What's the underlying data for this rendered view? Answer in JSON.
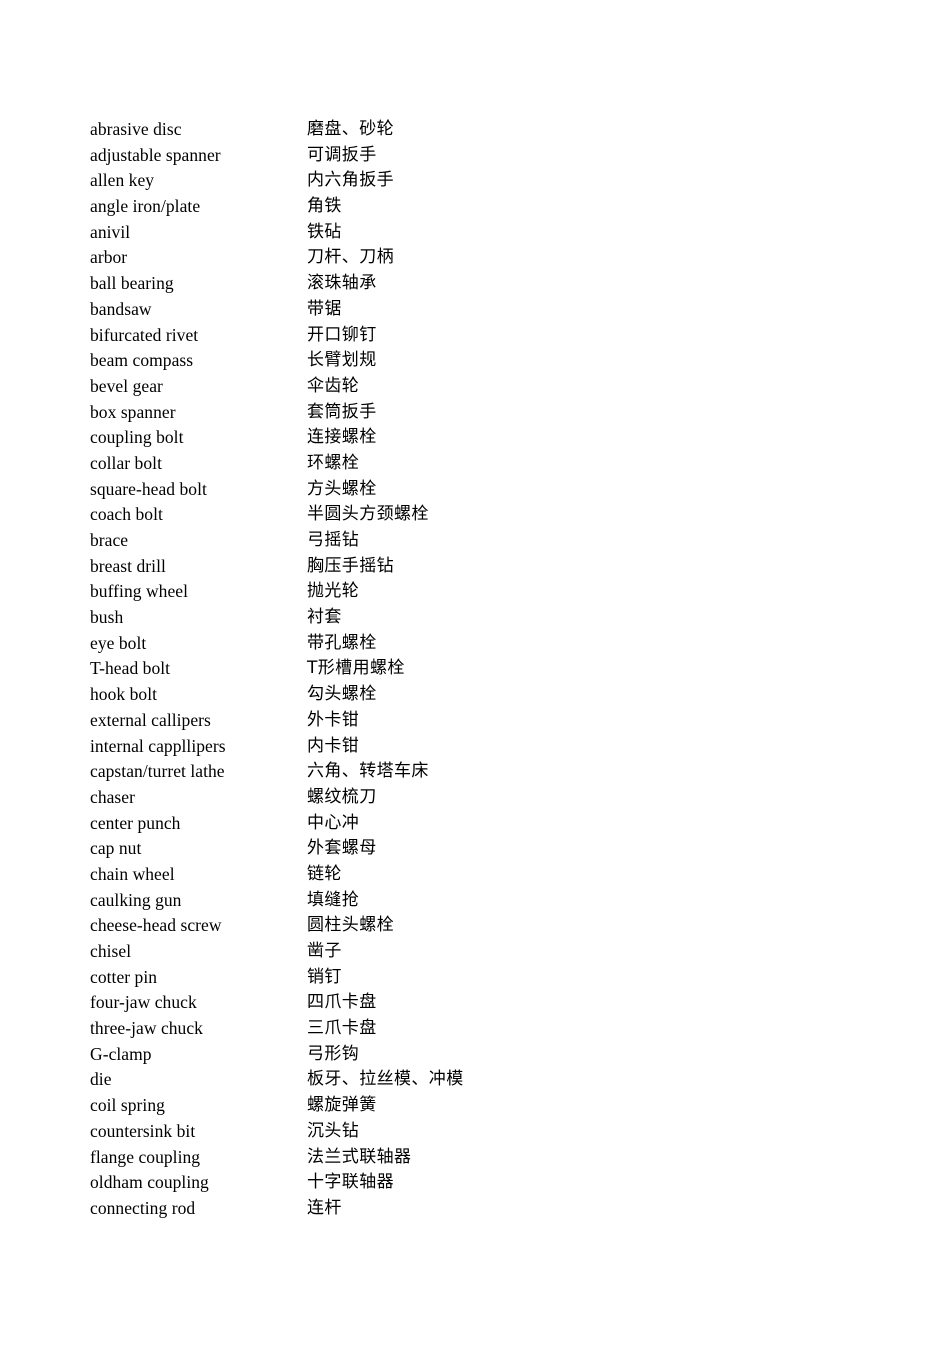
{
  "document": {
    "type": "bilingual-glossary",
    "subject": "mechanical engineering tools and fasteners",
    "source_language": "English",
    "target_language": "Chinese",
    "entry_count": 43
  },
  "entries": [
    {
      "term": "abrasive disc",
      "gloss": "磨盘、砂轮"
    },
    {
      "term": "adjustable spanner",
      "gloss": "可调扳手"
    },
    {
      "term": "allen key",
      "gloss": "内六角扳手"
    },
    {
      "term": "angle iron/plate",
      "gloss": "角铁"
    },
    {
      "term": "anivil",
      "gloss": "铁砧"
    },
    {
      "term": "arbor",
      "gloss": "刀杆、刀柄"
    },
    {
      "term": "ball bearing",
      "gloss": "滚珠轴承"
    },
    {
      "term": "bandsaw",
      "gloss": "带锯"
    },
    {
      "term": "bifurcated rivet",
      "gloss": "开口铆钉"
    },
    {
      "term": "beam compass",
      "gloss": "长臂划规"
    },
    {
      "term": "bevel gear",
      "gloss": "伞齿轮"
    },
    {
      "term": "box spanner",
      "gloss": "套筒扳手"
    },
    {
      "term": "coupling bolt",
      "gloss": "连接螺栓"
    },
    {
      "term": "collar bolt",
      "gloss": "环螺栓"
    },
    {
      "term": "square-head bolt",
      "gloss": "方头螺栓"
    },
    {
      "term": "coach bolt",
      "gloss": "半圆头方颈螺栓"
    },
    {
      "term": "brace",
      "gloss": "弓摇钻"
    },
    {
      "term": "breast drill",
      "gloss": "胸压手摇钻"
    },
    {
      "term": "buffing wheel",
      "gloss": "抛光轮"
    },
    {
      "term": "bush",
      "gloss": "衬套"
    },
    {
      "term": "eye bolt",
      "gloss": "带孔螺栓"
    },
    {
      "term": "T-head bolt",
      "gloss": "T形槽用螺栓"
    },
    {
      "term": "hook bolt",
      "gloss": "勾头螺栓"
    },
    {
      "term": "external callipers",
      "gloss": "外卡钳"
    },
    {
      "term": "internal cappllipers",
      "gloss": "内卡钳"
    },
    {
      "term": "capstan/turret lathe",
      "gloss": "六角、转塔车床"
    },
    {
      "term": "chaser",
      "gloss": "螺纹梳刀"
    },
    {
      "term": "center punch",
      "gloss": "中心冲"
    },
    {
      "term": "cap nut",
      "gloss": "外套螺母"
    },
    {
      "term": "chain wheel",
      "gloss": "链轮"
    },
    {
      "term": "caulking gun",
      "gloss": "填缝抢"
    },
    {
      "term": "cheese-head screw",
      "gloss": "圆柱头螺栓"
    },
    {
      "term": "chisel",
      "gloss": "凿子"
    },
    {
      "term": "cotter pin",
      "gloss": "销钉"
    },
    {
      "term": "four-jaw chuck",
      "gloss": "四爪卡盘"
    },
    {
      "term": "three-jaw chuck",
      "gloss": "三爪卡盘"
    },
    {
      "term": "G-clamp",
      "gloss": "弓形钩"
    },
    {
      "term": "die",
      "gloss": "板牙、拉丝模、冲模"
    },
    {
      "term": "coil spring",
      "gloss": "螺旋弹簧"
    },
    {
      "term": "countersink bit",
      "gloss": "沉头钻"
    },
    {
      "term": "flange coupling",
      "gloss": "法兰式联轴器"
    },
    {
      "term": "oldham coupling",
      "gloss": "十字联轴器"
    },
    {
      "term": "connecting rod",
      "gloss": "连杆"
    }
  ]
}
